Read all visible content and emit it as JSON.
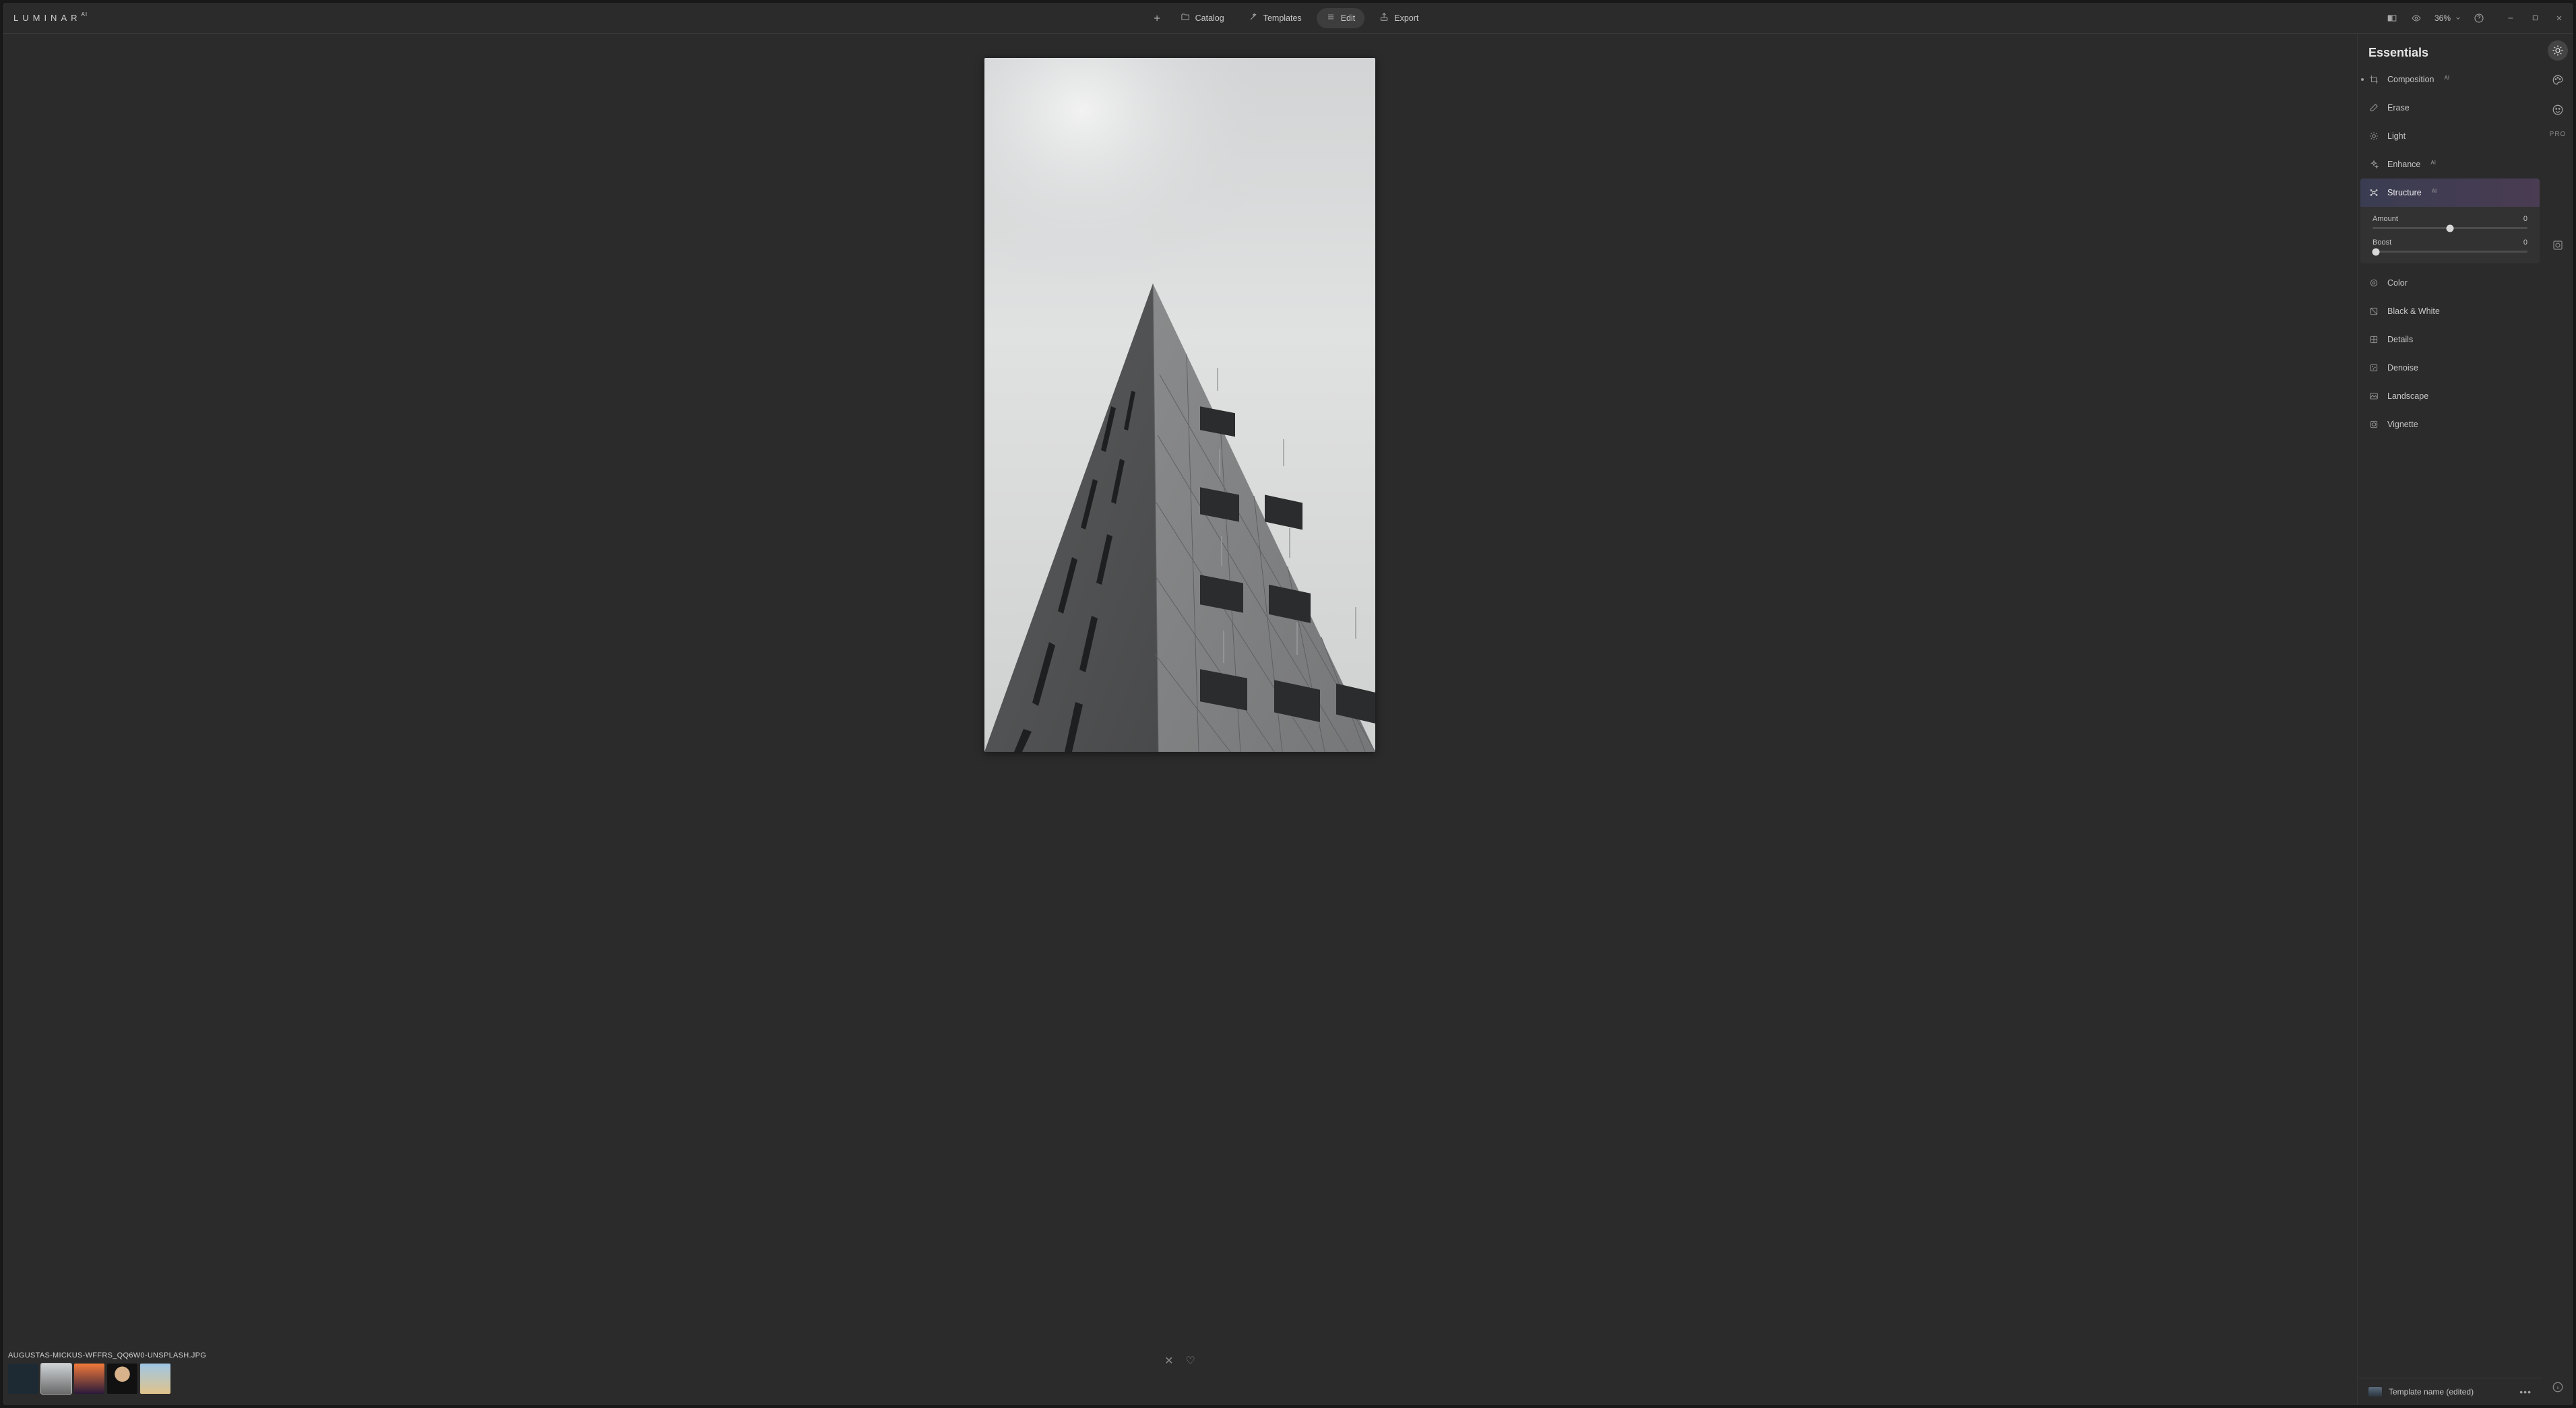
{
  "app": {
    "brand": "LUMINAR",
    "brand_suffix": "AI"
  },
  "nav": {
    "catalog": "Catalog",
    "templates": "Templates",
    "edit": "Edit",
    "export": "Export"
  },
  "zoom": {
    "value": "36%"
  },
  "panel": {
    "title": "Essentials",
    "tools": {
      "composition": {
        "label": "Composition",
        "ai": true,
        "modified": true
      },
      "erase": {
        "label": "Erase"
      },
      "light": {
        "label": "Light"
      },
      "enhance": {
        "label": "Enhance",
        "ai": true
      },
      "structure": {
        "label": "Structure",
        "ai": true,
        "expanded": true,
        "sliders": {
          "amount": {
            "label": "Amount",
            "value": "0",
            "pos": 50
          },
          "boost": {
            "label": "Boost",
            "value": "0",
            "pos": 0
          }
        }
      },
      "color": {
        "label": "Color"
      },
      "blackwhite": {
        "label": "Black & White"
      },
      "details": {
        "label": "Details"
      },
      "denoise": {
        "label": "Denoise"
      },
      "landscape": {
        "label": "Landscape"
      },
      "vignette": {
        "label": "Vignette"
      }
    }
  },
  "template_footer": {
    "name": "Template name (edited)"
  },
  "rail": {
    "pro": "PRO"
  },
  "filmstrip": {
    "filename": "AUGUSTAS-MICKUS-WFFRS_QQ6W0-UNSPLASH.JPG",
    "thumbs": [
      {
        "name": "thumb-1",
        "style": "background:#1d2a33"
      },
      {
        "name": "thumb-2",
        "style": "background:linear-gradient(#cfd3d6,#6a6a6a)"
      },
      {
        "name": "thumb-3",
        "style": "background:linear-gradient(#f27a3b,#2a1a3a)"
      },
      {
        "name": "thumb-4",
        "style": "background:radial-gradient(circle at 50% 35%, #d8b28a 0 30%, #111 31%)"
      },
      {
        "name": "thumb-5",
        "style": "background:linear-gradient(#9fc6e6,#e0c48a)"
      }
    ]
  }
}
